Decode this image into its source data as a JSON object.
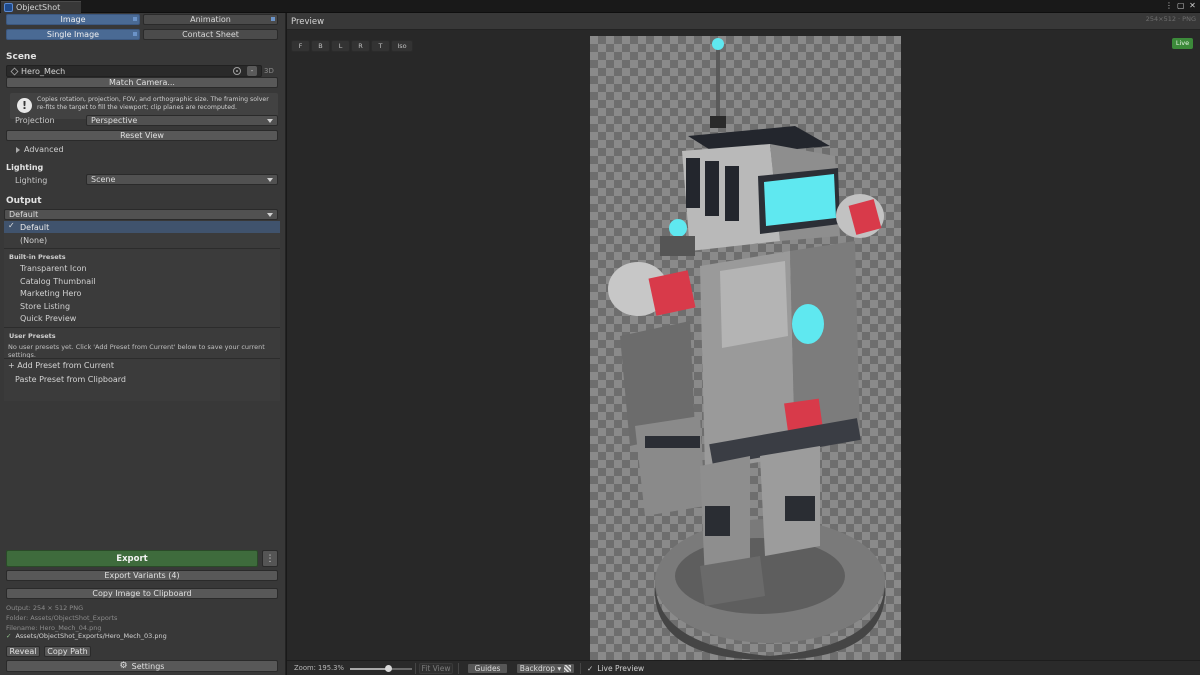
{
  "window": {
    "tab_title": "ObjectShot",
    "controls": [
      "⋮",
      "▢",
      "✕"
    ]
  },
  "mode_tabs": [
    {
      "label": "Image",
      "active": true
    },
    {
      "label": "Animation",
      "active": false
    }
  ],
  "submode_tabs": [
    {
      "label": "Single Image",
      "active": true
    },
    {
      "label": "Contact Sheet",
      "active": false
    }
  ],
  "scene": {
    "title": "Scene",
    "object_name": "Hero_Mech",
    "object_btn": "-",
    "mode_badge": "3D",
    "match_camera_label": "Match Camera...",
    "info_text": "Copies rotation, projection, FOV, and orthographic size. The framing solver re-fits the target to fill the viewport; clip planes are recomputed.",
    "projection_label": "Projection",
    "projection_value": "Perspective",
    "reset_view_label": "Reset View",
    "advanced_label": "Advanced"
  },
  "lighting": {
    "title": "Lighting",
    "label": "Lighting",
    "value": "Scene"
  },
  "output": {
    "title": "Output",
    "selected": "Default",
    "menu": {
      "items": [
        "Default",
        "(None)"
      ],
      "builtin_header": "Built-in Presets",
      "builtin": [
        "Transparent Icon",
        "Catalog Thumbnail",
        "Marketing Hero",
        "Store Listing",
        "Quick Preview"
      ],
      "user_header": "User Presets",
      "user_note": "No user presets yet. Click 'Add Preset from Current' below to save your current settings.",
      "add_preset": "+  Add Preset from Current",
      "paste_preset": "Paste Preset from Clipboard"
    }
  },
  "actions": {
    "export": "Export",
    "export_more": "⋮",
    "export_variants": "Export Variants (4)",
    "copy_clipboard": "Copy Image to Clipboard",
    "meta_output": "Output: 254 × 512 PNG",
    "meta_folder": "Folder: Assets/ObjectShot_Exports",
    "meta_filename": "Filename: Hero_Mech_04.png",
    "last_check": "✓",
    "last_path": "Assets/ObjectShot_Exports/Hero_Mech_03.png",
    "reveal": "Reveal",
    "copy_path": "Copy Path",
    "settings": "Settings"
  },
  "preview": {
    "title": "Preview",
    "size": "254×512 · PNG",
    "live": "Live",
    "view_buttons": [
      "F",
      "B",
      "L",
      "R",
      "T",
      "Iso"
    ]
  },
  "bottombar": {
    "zoom_label": "Zoom: 195.3%",
    "zoom_fraction": 0.62,
    "fit_view": "Fit View",
    "guides": "Guides",
    "backdrop": "Backdrop ▾",
    "backdrop_icon": "checker-icon",
    "live_check": "✓",
    "live_preview": "Live Preview"
  },
  "colors": {
    "accent_blue": "#4a6a94",
    "export_green": "#3e6b3c",
    "live_green": "#3c8a3a",
    "visor_cyan": "#5fe8f0",
    "panel_red": "#d83a4a"
  }
}
